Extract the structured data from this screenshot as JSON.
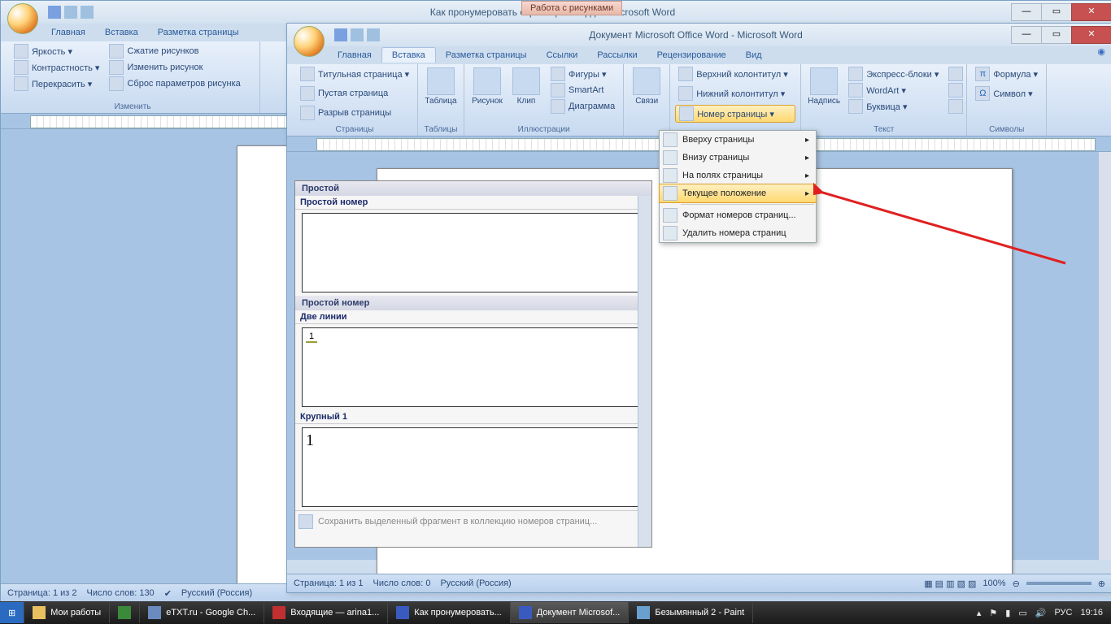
{
  "win1": {
    "title": "Как пронумеровать страницы в ворде - Microsoft Word",
    "contextual_tab": "Работа с рисунками",
    "tabs": [
      "Главная",
      "Вставка",
      "Разметка страницы"
    ],
    "ribbon": {
      "brightness": "Яркость ▾",
      "contrast": "Контрастность ▾",
      "recolor": "Перекрасить ▾",
      "compress": "Сжатие рисунков",
      "change_pic": "Изменить рисунок",
      "reset": "Сброс параметров рисунка",
      "group_label": "Изменить"
    },
    "status": {
      "page": "Страница: 1 из 2",
      "words": "Число слов: 130",
      "lang": "Русский (Россия)"
    }
  },
  "win2": {
    "title": "Документ Microsoft Office Word - Microsoft Word",
    "tabs": {
      "home": "Главная",
      "insert": "Вставка",
      "layout": "Разметка страницы",
      "refs": "Ссылки",
      "mail": "Рассылки",
      "review": "Рецензирование",
      "view": "Вид"
    },
    "ribbon": {
      "title_page": "Титульная страница ▾",
      "blank_page": "Пустая страница",
      "page_break": "Разрыв страницы",
      "pages_group": "Страницы",
      "table": "Таблица",
      "tables_group": "Таблицы",
      "picture": "Рисунок",
      "clip": "Клип",
      "shapes": "Фигуры ▾",
      "smartart": "SmartArt",
      "chart": "Диаграмма",
      "illustrations_group": "Иллюстрации",
      "links": "Связи",
      "header": "Верхний колонтитул ▾",
      "footer": "Нижний колонтитул ▾",
      "pagenum": "Номер страницы ▾",
      "textbox": "Надпись",
      "quickparts": "Экспресс-блоки ▾",
      "wordart": "WordArt ▾",
      "dropcap": "Буквица ▾",
      "text_group": "Текст",
      "equation": "Формула ▾",
      "symbol": "Символ ▾",
      "symbols_group": "Символы"
    },
    "pagenum_menu": {
      "top": "Вверху страницы",
      "bottom": "Внизу страницы",
      "margins": "На полях страницы",
      "current": "Текущее положение",
      "format": "Формат номеров страниц...",
      "remove": "Удалить номера страниц"
    },
    "gallery": {
      "header": "Простой",
      "item1": "Простой номер",
      "item2_hdr": "Простой номер",
      "item2": "Две линии",
      "item3": "Крупный 1",
      "sample": "1",
      "footer": "Сохранить выделенный фрагмент в коллекцию номеров страниц..."
    },
    "status": {
      "page": "Страница: 1 из 1",
      "words": "Число слов: 0",
      "lang": "Русский (Россия)",
      "zoom": "100%"
    }
  },
  "taskbar": {
    "items": [
      {
        "label": "Мои работы"
      },
      {
        "label": "eTXT.ru - Google Ch..."
      },
      {
        "label": "Входящие — arina1..."
      },
      {
        "label": "Как пронумеровать..."
      },
      {
        "label": "Документ Microsof..."
      },
      {
        "label": "Безымянный 2 - Paint"
      }
    ],
    "lang": "РУС",
    "time": "19:16"
  }
}
